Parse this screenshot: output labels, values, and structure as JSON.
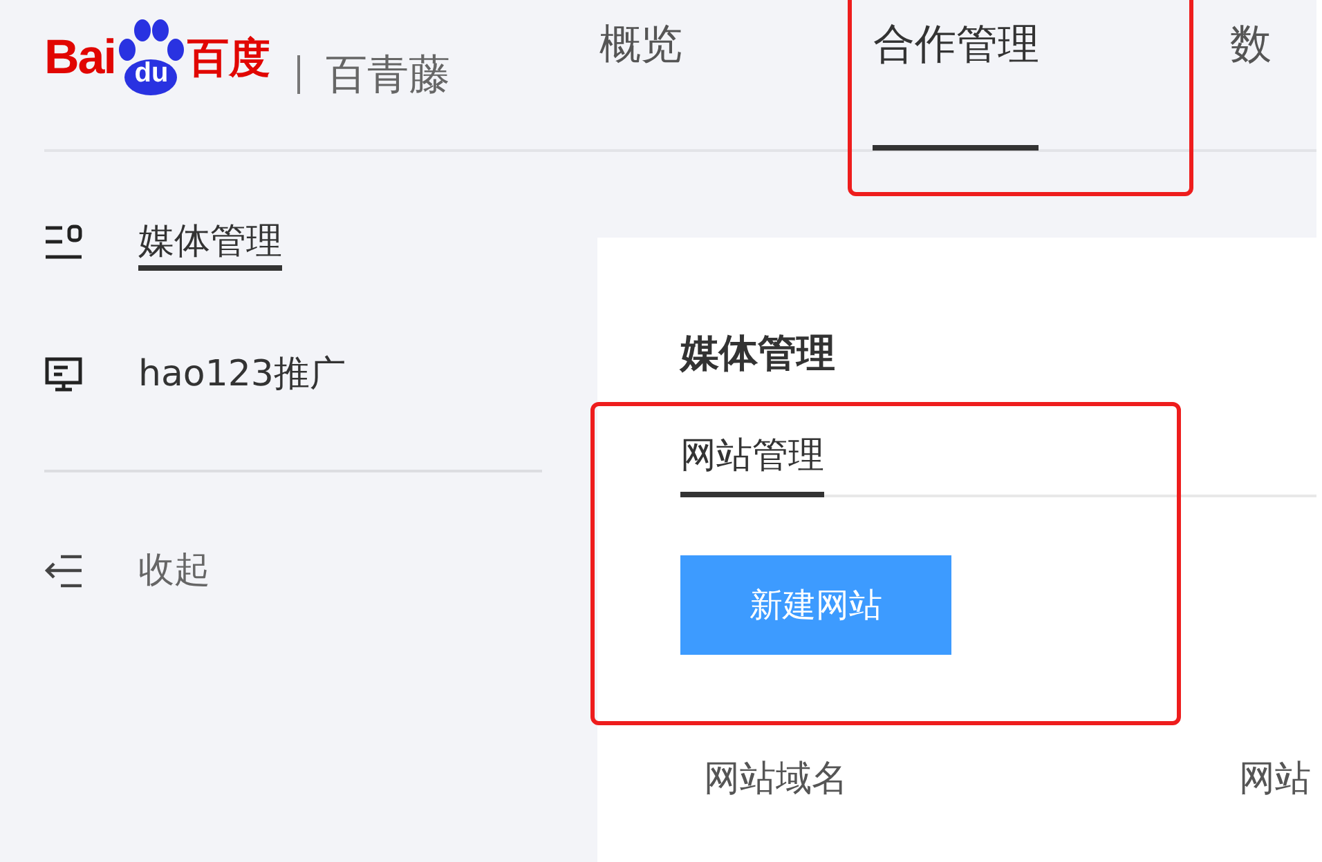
{
  "brand": {
    "logo_left": "Bai",
    "logo_paw": "du",
    "logo_right": "百度",
    "product": "百青藤"
  },
  "nav": [
    {
      "label": "概览",
      "selected": false
    },
    {
      "label": "合作管理",
      "selected": true
    },
    {
      "label": "数",
      "selected": false
    }
  ],
  "sidebar": {
    "items": [
      {
        "label": "媒体管理",
        "selected": true
      },
      {
        "label": "hao123推广",
        "selected": false
      }
    ],
    "collapse": "收起"
  },
  "page": {
    "title": "媒体管理",
    "tabs": [
      {
        "label": "网站管理",
        "selected": true
      }
    ],
    "create_button": "新建网站",
    "table": {
      "columns": [
        "网站域名",
        "网站"
      ]
    }
  },
  "annotation_boxes": [
    {
      "kind": "box"
    },
    {
      "kind": "box"
    }
  ]
}
